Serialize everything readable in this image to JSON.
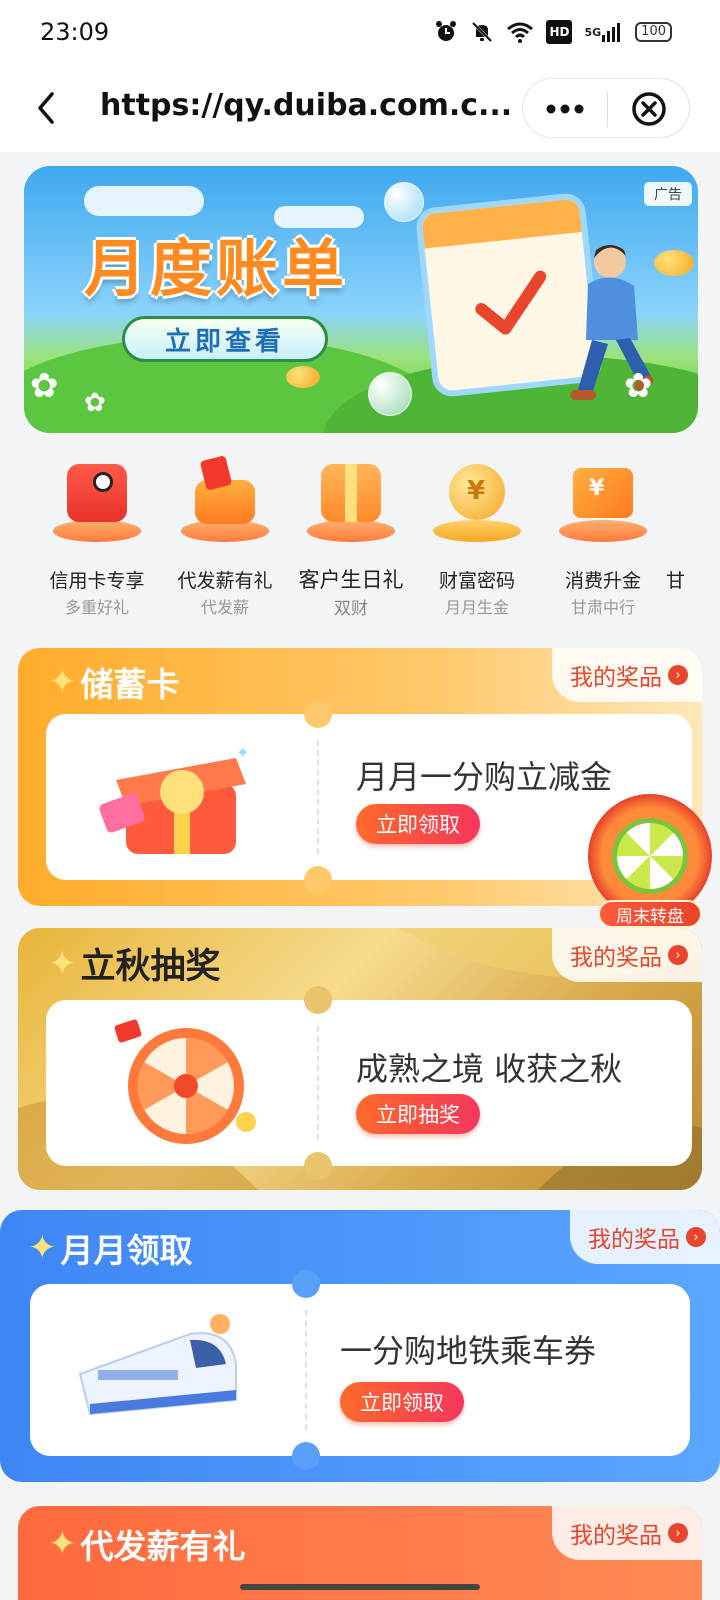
{
  "status_bar": {
    "time": "23:09",
    "icons": [
      "alarm-icon",
      "mute-icon",
      "wifi-icon",
      "hd-icon",
      "signal-5g-icon",
      "battery-icon"
    ],
    "hd_label": "HD",
    "network_label": "5G",
    "battery_level": "100"
  },
  "browser": {
    "url": "https://qy.duiba.com.c...",
    "back_icon": "chevron-left-icon",
    "more_icon": "more-dots-icon",
    "close_icon": "close-circle-icon"
  },
  "banner": {
    "title": "月度账单",
    "button_label": "立即查看",
    "ad_label": "广告"
  },
  "categories": [
    {
      "label": "信用卡专享",
      "sub": "多重好礼"
    },
    {
      "label": "代发薪有礼",
      "sub": "代发薪"
    },
    {
      "label": "客户生日礼",
      "sub": "双财"
    },
    {
      "label": "财富密码",
      "sub": "月月生金"
    },
    {
      "label": "消费升金",
      "sub": "甘肃中行"
    },
    {
      "label": "甘",
      "sub": ""
    }
  ],
  "cards": [
    {
      "title": "储蓄卡",
      "prize_label": "我的奖品",
      "text": "月月一分购立减金",
      "button": "立即领取"
    },
    {
      "title": "立秋抽奖",
      "prize_label": "我的奖品",
      "text": "成熟之境  收获之秋",
      "button": "立即抽奖"
    },
    {
      "title": "月月领取",
      "prize_label": "我的奖品",
      "text": "一分购地铁乘车券",
      "button": "立即领取"
    },
    {
      "title": "代发薪有礼",
      "prize_label": "我的奖品"
    }
  ],
  "float_widget": {
    "label": "周末转盘"
  },
  "colors": {
    "accent_red": "#e8452c",
    "card1_orange": "#ffac2b",
    "card3_blue": "#3e86f5",
    "card4_orange": "#ff6a3d"
  }
}
